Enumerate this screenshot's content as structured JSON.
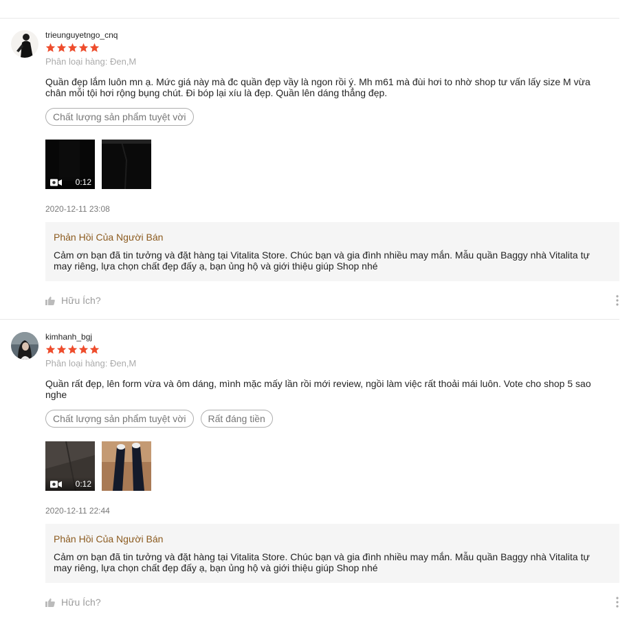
{
  "reviews": [
    {
      "username": "trieunguyetngo_cnq",
      "rating": 5,
      "variation": "Phân loại hàng: Đen,M",
      "content": "Quần đẹp lắm luôn mn ạ. Mức giá này mà đc quần đẹp vầy là ngon rồi ý. Mh m61 mà đùi hơi to nhờ shop tư vấn lấy size M vừa chân mỗi tội hơi rộng bụng chút. Đi bóp lại xíu là đẹp. Quần lên dáng thẳng đẹp.",
      "tags": [
        "Chất lượng sản phẩm tuyệt vời"
      ],
      "video_duration": "0:12",
      "timestamp": "2020-12-11 23:08",
      "seller_reply_title": "Phản Hồi Của Người Bán",
      "seller_reply": "Cảm ơn bạn đã tin tưởng và đặt hàng tại Vitalita Store. Chúc bạn và gia đình nhiều may mắn. Mẫu quần Baggy nhà Vitalita tự may riêng, lựa chọn chất đẹp đấy ạ, bạn ủng hộ và giới thiệu giúp Shop nhé",
      "helpful_label": "Hữu Ích?"
    },
    {
      "username": "kimhanh_bgj",
      "rating": 5,
      "variation": "Phân loại hàng: Đen,M",
      "content": "Quần rất đẹp, lên form vừa  và ôm dáng, mình mặc mấy lần rồi mới review, ngồi làm việc rất thoải mái luôn. Vote cho shop 5 sao nghe",
      "tags": [
        "Chất lượng sản phẩm tuyệt vời",
        "Rất đáng tiền"
      ],
      "video_duration": "0:12",
      "timestamp": "2020-12-11 22:44",
      "seller_reply_title": "Phản Hồi Của Người Bán",
      "seller_reply": "Cảm ơn bạn đã tin tưởng và đặt hàng tại Vitalita Store. Chúc bạn và gia đình nhiều may mắn. Mẫu quần Baggy nhà Vitalita tự may riêng, lựa chọn chất đẹp đấy ạ, bạn ủng hộ và giới thiệu giúp Shop nhé",
      "helpful_label": "Hữu Ích?"
    }
  ],
  "colors": {
    "star": "#ee4d2d",
    "reply_title": "#8b5a1e",
    "reply_bg": "#f5f5f5"
  },
  "icons": [
    "star-icon",
    "video-camera-icon",
    "thumbs-up-icon",
    "more-vertical-icon"
  ]
}
